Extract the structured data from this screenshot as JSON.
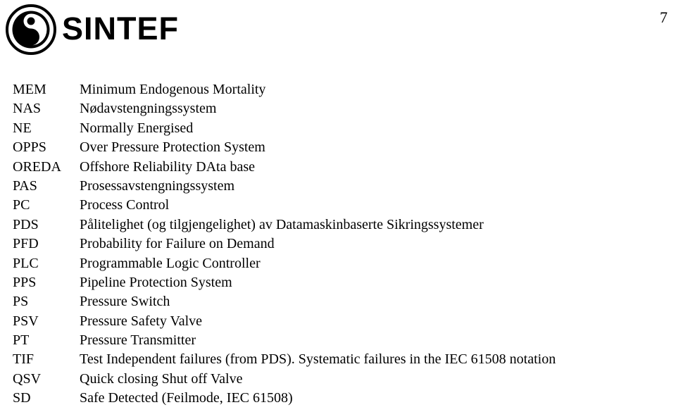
{
  "header": {
    "logo_text": "SINTEF",
    "logo_icon": "sintef-circle-logo-icon",
    "page_number": "7"
  },
  "abbreviations": [
    {
      "term": "MEM",
      "definition": "Minimum Endogenous Mortality"
    },
    {
      "term": "NAS",
      "definition": "Nødavstengningssystem"
    },
    {
      "term": "NE",
      "definition": "Normally Energised"
    },
    {
      "term": "OPPS",
      "definition": "Over Pressure Protection System"
    },
    {
      "term": "OREDA",
      "definition": "Offshore Reliability DAta base"
    },
    {
      "term": "PAS",
      "definition": "Prosessavstengningssystem"
    },
    {
      "term": "PC",
      "definition": "Process Control"
    },
    {
      "term": "PDS",
      "definition": "Pålitelighet (og tilgjengelighet) av Datamaskinbaserte Sikringssystemer"
    },
    {
      "term": "PFD",
      "definition": "Probability for Failure on Demand"
    },
    {
      "term": "PLC",
      "definition": "Programmable Logic Controller"
    },
    {
      "term": "PPS",
      "definition": "Pipeline Protection System"
    },
    {
      "term": "PS",
      "definition": "Pressure Switch"
    },
    {
      "term": "PSV",
      "definition": "Pressure Safety Valve"
    },
    {
      "term": "PT",
      "definition": "Pressure Transmitter"
    },
    {
      "term": "TIF",
      "definition": "Test Independent failures (from PDS). Systematic failures in the IEC 61508 notation"
    },
    {
      "term": "QSV",
      "definition": "Quick closing Shut off Valve"
    },
    {
      "term": "SD",
      "definition": "Safe Detected (Feilmode, IEC 61508)"
    }
  ]
}
